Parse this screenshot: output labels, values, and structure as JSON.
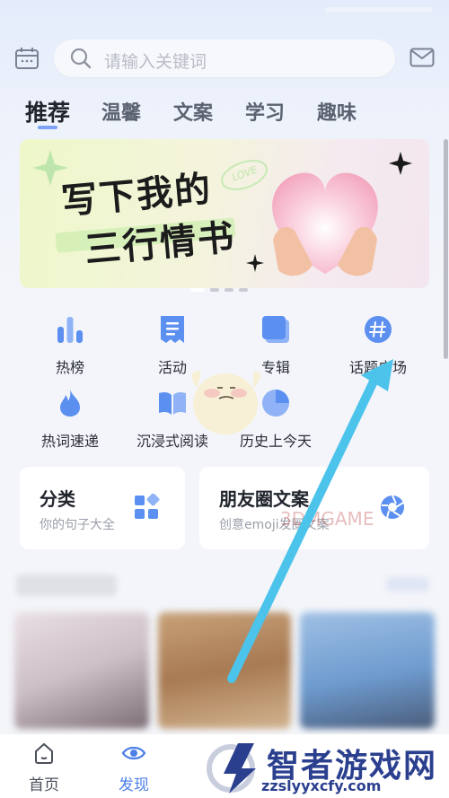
{
  "header": {
    "search_placeholder": "请输入关键词"
  },
  "tabs": [
    {
      "label": "推荐",
      "active": true
    },
    {
      "label": "温馨",
      "active": false
    },
    {
      "label": "文案",
      "active": false
    },
    {
      "label": "学习",
      "active": false
    },
    {
      "label": "趣味",
      "active": false
    }
  ],
  "banner": {
    "line1": "写下我的",
    "line2": "三行情书",
    "badge": "LOVE",
    "page_count": 4,
    "active_page": 0
  },
  "grid": [
    {
      "label": "热榜",
      "icon": "bar-chart-icon"
    },
    {
      "label": "活动",
      "icon": "document-icon"
    },
    {
      "label": "专辑",
      "icon": "album-icon"
    },
    {
      "label": "话题广场",
      "icon": "hashtag-icon"
    },
    {
      "label": "热词速递",
      "icon": "flame-icon"
    },
    {
      "label": "沉浸式阅读",
      "icon": "open-book-icon"
    },
    {
      "label": "历史上今天",
      "icon": "calendar-pie-icon"
    }
  ],
  "cards": [
    {
      "title": "分类",
      "subtitle": "你的句子大全",
      "icon": "category-grid-icon"
    },
    {
      "title": "朋友圈文案",
      "subtitle": "创意emoji发圈文案",
      "icon": "aperture-icon"
    }
  ],
  "nav": [
    {
      "label": "首页",
      "icon": "home-icon",
      "active": false
    },
    {
      "label": "发现",
      "icon": "eye-icon",
      "active": true
    }
  ],
  "watermark": {
    "title": "智者游戏网",
    "url": "zzslyyxcfy.com",
    "ghost": "3DMGAME"
  },
  "colors": {
    "accent": "#4d7fe8",
    "icon_blue": "#5b8ff0",
    "arrow": "#4cc3ea",
    "banner_green": "#e9f5bf"
  }
}
